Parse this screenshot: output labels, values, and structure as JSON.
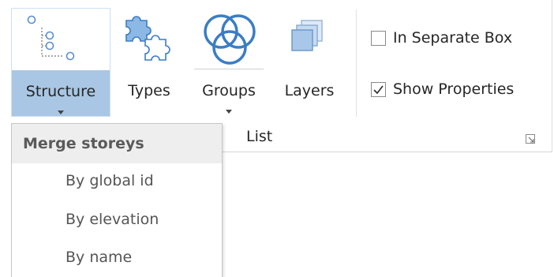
{
  "ribbon": {
    "buttons": {
      "structure": {
        "label": "Structure",
        "icon": "tree-structure-icon"
      },
      "types": {
        "label": "Types",
        "icon": "puzzle-pieces-icon"
      },
      "groups": {
        "label": "Groups",
        "icon": "overlapping-circles-icon"
      },
      "layers": {
        "label": "Layers",
        "icon": "stacked-layers-icon"
      }
    },
    "checkboxes": {
      "in_separate_box": {
        "label": "In Separate Box",
        "checked": false
      },
      "show_properties": {
        "label": "Show Properties",
        "checked": true
      }
    },
    "group_label": "List",
    "launcher_icon": "dialog-launcher-icon"
  },
  "dropdown": {
    "header": "Merge storeys",
    "items": [
      "By global id",
      "By elevation",
      "By name"
    ]
  },
  "colors": {
    "accent_blue": "#a9c7e4",
    "icon_blue": "#3b7dc4",
    "icon_light_blue": "#8cb8e6"
  }
}
